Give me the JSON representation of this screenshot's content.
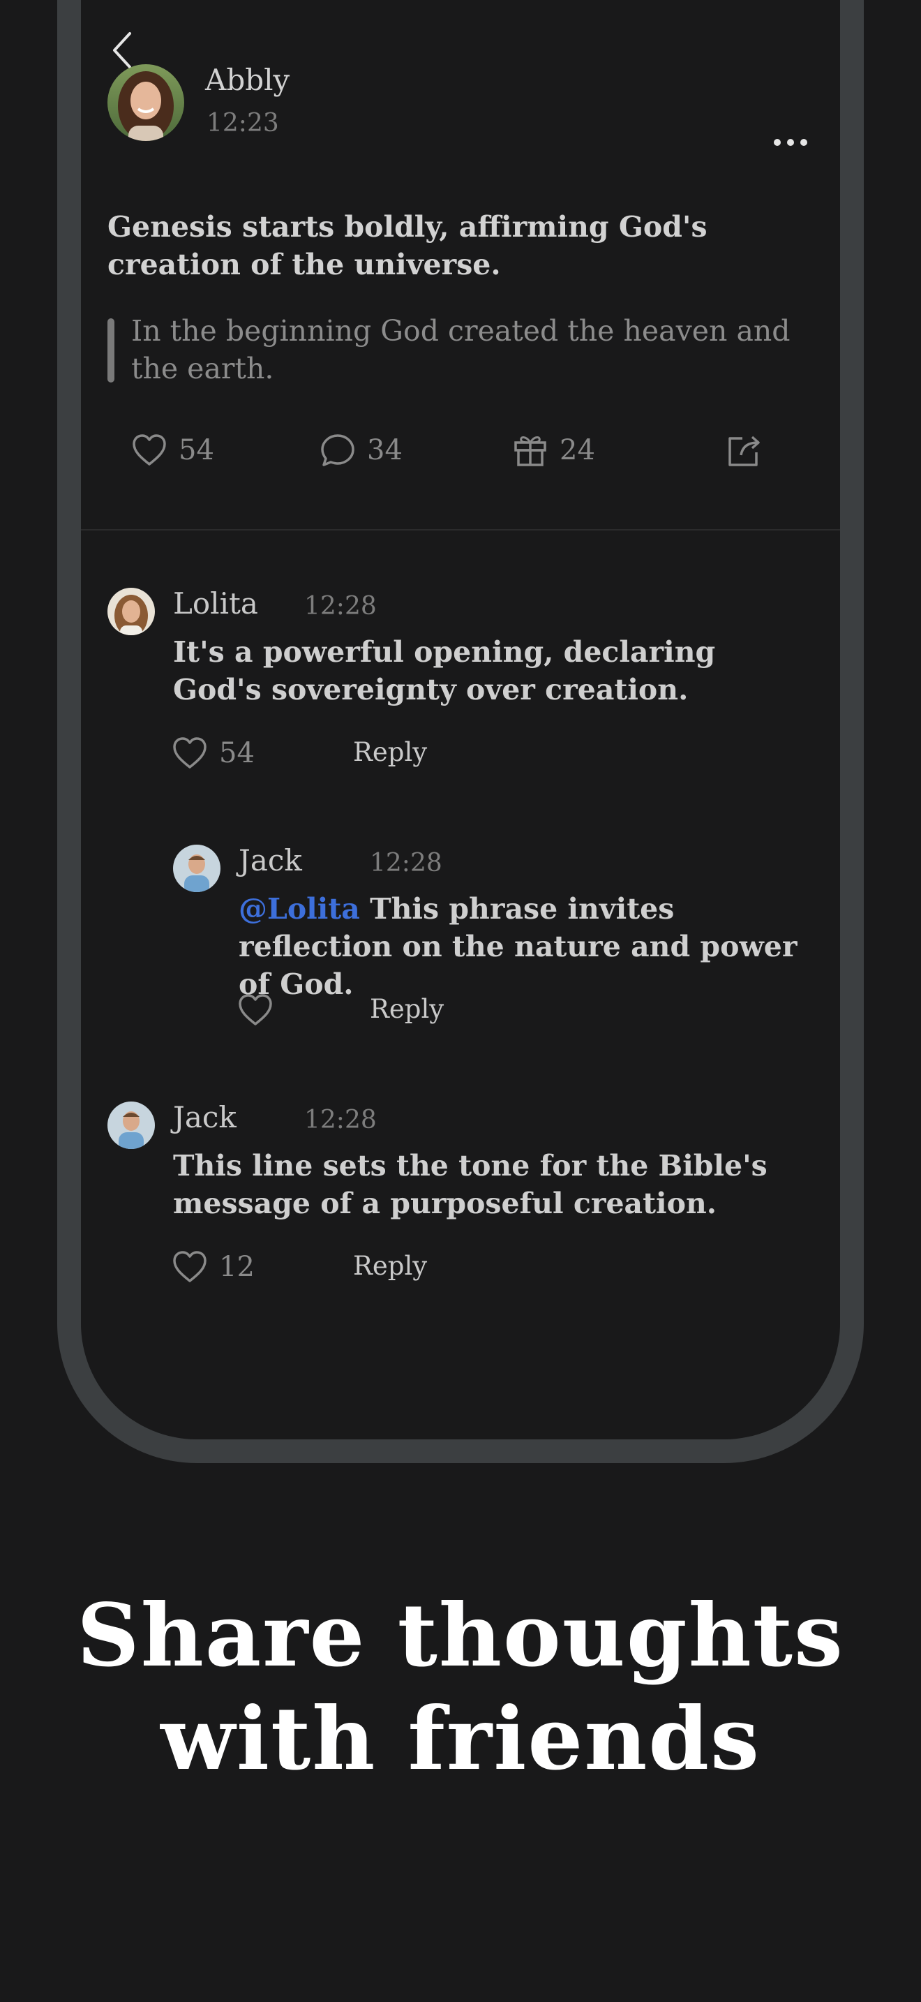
{
  "post": {
    "author": "Abbly",
    "time": "12:23",
    "title": "Genesis starts boldly, affirming God's creation of the universe.",
    "quote": "In the beginning God created the heaven and the earth.",
    "stats": {
      "likes": "54",
      "comments": "34",
      "gifts": "24"
    }
  },
  "comments": [
    {
      "author": "Lolita",
      "time": "12:28",
      "text": "It's a powerful opening, declaring God's sovereignty over creation.",
      "likes": "54",
      "reply_label": "Reply"
    },
    {
      "author": "Jack",
      "time": "12:28",
      "mention": "@Lolita",
      "text": " This phrase invites reflection on the nature and power of God.",
      "likes": "",
      "reply_label": "Reply"
    },
    {
      "author": "Jack",
      "time": "12:28",
      "text": "This line sets the tone for the Bible's message of a purposeful creation.",
      "likes": "12",
      "reply_label": "Reply"
    }
  ],
  "tagline": {
    "line1": "Share thoughts",
    "line2": "with friends"
  },
  "icons": [
    "back-icon",
    "more-icon",
    "heart-icon",
    "comment-icon",
    "gift-icon",
    "share-icon"
  ],
  "colors": {
    "background": "#19191a",
    "phone_frame": "#3c3f41",
    "mention": "#3d6fdb"
  }
}
